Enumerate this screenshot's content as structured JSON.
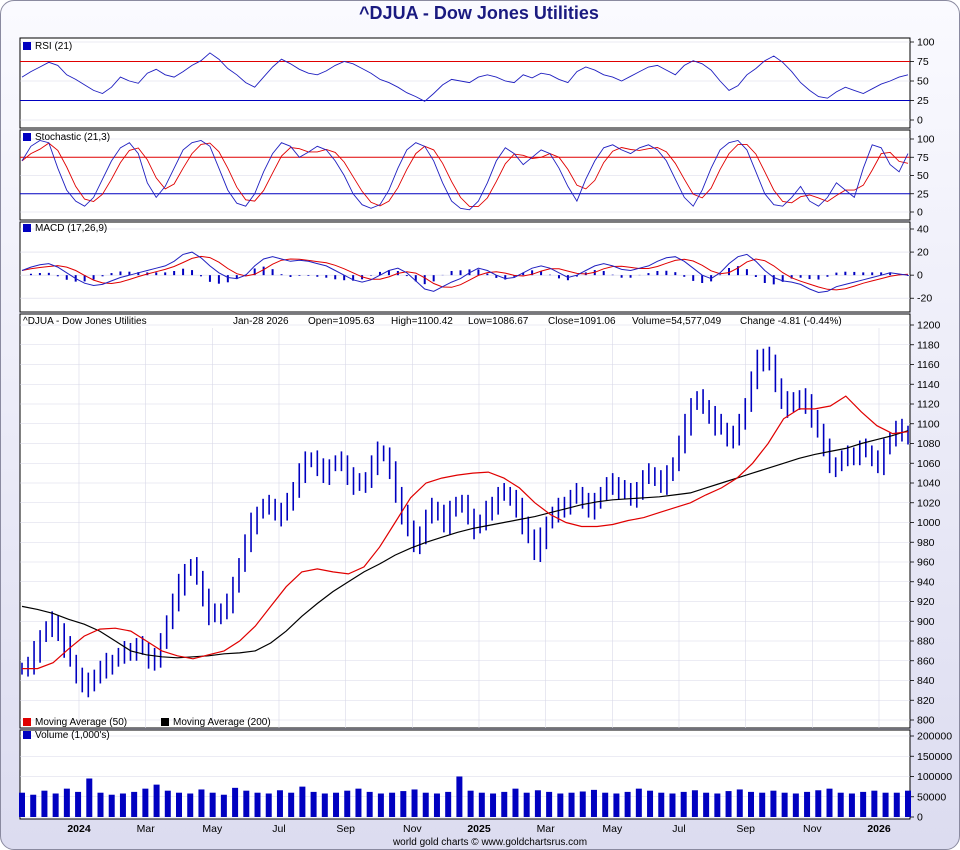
{
  "title": "^DJUA - Dow Jones Utilities",
  "footer": "world gold charts © www.goldchartsrus.com",
  "colors": {
    "price": "#0000c0",
    "ma50": "#e00000",
    "ma200": "#000000",
    "rsi": "#2020c0",
    "ref_red": "#e00000",
    "ref_blue": "#0000c0",
    "volume": "#0000c0"
  },
  "chart_data": [
    {
      "type": "line",
      "panel": "rsi",
      "legend": "RSI (21)",
      "ylim": [
        0,
        100
      ],
      "ticks": [
        0,
        25,
        50,
        75,
        100
      ],
      "reference_lines": [
        25,
        75
      ],
      "series": [
        {
          "values": [
            55,
            62,
            68,
            74,
            70,
            58,
            52,
            45,
            38,
            34,
            42,
            55,
            50,
            47,
            60,
            65,
            58,
            55,
            62,
            70,
            76,
            86,
            78,
            66,
            58,
            48,
            42,
            55,
            68,
            78,
            72,
            65,
            60,
            58,
            63,
            70,
            75,
            72,
            66,
            60,
            52,
            48,
            42,
            35,
            30,
            24,
            34,
            45,
            52,
            50,
            48,
            55,
            58,
            55,
            50,
            48,
            58,
            54,
            60,
            58,
            52,
            48,
            62,
            68,
            64,
            58,
            55,
            50,
            56,
            62,
            68,
            70,
            64,
            58,
            70,
            76,
            72,
            64,
            50,
            38,
            44,
            58,
            66,
            76,
            82,
            74,
            62,
            48,
            38,
            30,
            28,
            36,
            42,
            38,
            34,
            40,
            46,
            50,
            55,
            58
          ]
        }
      ]
    },
    {
      "type": "line",
      "panel": "stochastic",
      "legend": "Stochastic (21,3)",
      "ylim": [
        0,
        100
      ],
      "ticks": [
        0,
        25,
        50,
        75,
        100
      ],
      "reference_lines": [
        25,
        75
      ],
      "series": [
        {
          "values": [
            70,
            90,
            98,
            95,
            60,
            30,
            15,
            8,
            20,
            45,
            70,
            88,
            95,
            80,
            40,
            20,
            35,
            60,
            85,
            95,
            98,
            90,
            60,
            30,
            12,
            8,
            25,
            55,
            80,
            95,
            90,
            75,
            82,
            90,
            85,
            70,
            50,
            25,
            10,
            5,
            10,
            30,
            60,
            85,
            95,
            90,
            70,
            40,
            15,
            5,
            3,
            15,
            40,
            70,
            88,
            80,
            65,
            75,
            85,
            80,
            60,
            35,
            15,
            45,
            70,
            88,
            92,
            85,
            80,
            88,
            92,
            85,
            70,
            45,
            20,
            8,
            30,
            60,
            85,
            95,
            98,
            85,
            55,
            25,
            10,
            8,
            20,
            35,
            15,
            8,
            20,
            40,
            30,
            20,
            60,
            92,
            88,
            65,
            55,
            80
          ]
        }
      ]
    },
    {
      "type": "line",
      "panel": "macd",
      "legend": "MACD (17,26,9)",
      "ylim": [
        -25,
        40
      ],
      "ticks": [
        -20,
        0,
        20,
        40
      ],
      "series": [
        {
          "values": [
            4,
            7,
            9,
            10,
            7,
            2,
            -3,
            -7,
            -9,
            -8,
            -5,
            -2,
            0,
            2,
            4,
            6,
            8,
            12,
            18,
            20,
            15,
            8,
            2,
            -2,
            -3,
            0,
            8,
            14,
            16,
            14,
            12,
            13,
            12,
            10,
            8,
            4,
            0,
            -4,
            -6,
            -4,
            0,
            4,
            6,
            2,
            -5,
            -12,
            -14,
            -10,
            -6,
            -3,
            2,
            6,
            4,
            0,
            -3,
            -2,
            2,
            6,
            8,
            6,
            2,
            -2,
            0,
            4,
            8,
            10,
            8,
            5,
            4,
            6,
            8,
            12,
            15,
            16,
            12,
            6,
            0,
            -3,
            2,
            10,
            16,
            18,
            12,
            4,
            -2,
            -5,
            -6,
            -8,
            -12,
            -15,
            -14,
            -10,
            -8,
            -6,
            -4,
            -2,
            0,
            2,
            1,
            0
          ]
        }
      ]
    },
    {
      "type": "line",
      "panel": "price",
      "info": {
        "label": "^DJUA - Dow Jones Utilities",
        "date": "Jan-28 2026",
        "open": "Open=1095.63",
        "high": "High=1100.42",
        "low": "Low=1086.67",
        "close": "Close=1091.06",
        "volume": "Volume=54,577,049",
        "change": "Change -4.81 (-0.44%)"
      },
      "ylim": [
        800,
        1200
      ],
      "ticks": [
        800,
        820,
        840,
        860,
        880,
        900,
        920,
        940,
        960,
        980,
        1000,
        1020,
        1040,
        1060,
        1080,
        1100,
        1120,
        1140,
        1160,
        1180,
        1200
      ],
      "x_ticks": [
        "2024",
        "Mar",
        "May",
        "Jul",
        "Sep",
        "Nov",
        "2025",
        "Mar",
        "May",
        "Jul",
        "Sep",
        "Nov",
        "2026"
      ],
      "legend": [
        "Moving Average (50)",
        "Moving Average (200)"
      ],
      "series": [
        {
          "name": "Moving Average (50)",
          "values": [
            852,
            852,
            858,
            872,
            885,
            892,
            893,
            890,
            880,
            870,
            865,
            862,
            866,
            870,
            880,
            895,
            915,
            935,
            950,
            953,
            950,
            948,
            955,
            975,
            1000,
            1025,
            1040,
            1045,
            1048,
            1050,
            1051,
            1045,
            1035,
            1020,
            1008,
            1000,
            996,
            996,
            998,
            1002,
            1005,
            1010,
            1015,
            1020,
            1028,
            1035,
            1045,
            1060,
            1080,
            1105,
            1115,
            1115,
            1118,
            1128,
            1112,
            1098,
            1090,
            1092
          ]
        },
        {
          "name": "Moving Average (200)",
          "values": [
            915,
            912,
            908,
            902,
            897,
            890,
            880,
            870,
            866,
            864,
            863,
            864,
            865,
            867,
            868,
            870,
            878,
            890,
            905,
            918,
            930,
            940,
            950,
            958,
            967,
            974,
            980,
            985,
            990,
            994,
            997,
            1000,
            1003,
            1006,
            1010,
            1014,
            1018,
            1021,
            1023,
            1024,
            1025,
            1026,
            1028,
            1030,
            1035,
            1040,
            1045,
            1050,
            1055,
            1060,
            1065,
            1069,
            1072,
            1075,
            1080,
            1084,
            1088,
            1093
          ]
        },
        {
          "name": "price",
          "values": [
            852,
            856,
            870,
            885,
            892,
            900,
            890,
            875,
            860,
            845,
            838,
            835,
            845,
            852,
            858,
            860,
            865,
            870,
            872,
            875,
            872,
            860,
            865,
            878,
            900,
            920,
            938,
            952,
            955,
            945,
            925,
            908,
            905,
            912,
            920,
            935,
            958,
            980,
            1000,
            1010,
            1016,
            1018,
            1012,
            1008,
            1020,
            1035,
            1052,
            1062,
            1065,
            1055,
            1050,
            1058,
            1060,
            1062,
            1048,
            1040,
            1038,
            1045,
            1060,
            1072,
            1068,
            1052,
            1030,
            1010,
            992,
            978,
            990,
            1005,
            1015,
            1010,
            1000,
            1012,
            1020,
            1018,
            1008,
            995,
            1000,
            1012,
            1020,
            1028,
            1030,
            1025,
            1015,
            1000,
            985,
            970,
            985,
            1000,
            1008,
            1015,
            1020,
            1025,
            1030,
            1022,
            1015,
            1020,
            1030,
            1038,
            1040,
            1035,
            1030,
            1025,
            1035,
            1045,
            1050,
            1045,
            1040,
            1048,
            1060,
            1080,
            1100,
            1120,
            1125,
            1118,
            1110,
            1100,
            1095,
            1085,
            1090,
            1100,
            1120,
            1145,
            1165,
            1170,
            1160,
            1140,
            1125,
            1118,
            1122,
            1128,
            1120,
            1108,
            1092,
            1075,
            1060,
            1058,
            1065,
            1068,
            1070,
            1075,
            1072,
            1065,
            1060,
            1075,
            1085,
            1095,
            1092,
            1091
          ]
        }
      ]
    },
    {
      "type": "bar",
      "panel": "volume",
      "legend": "Volume (1,000's)",
      "ylim": [
        0,
        200000
      ],
      "ticks": [
        0,
        50000,
        100000,
        150000,
        200000
      ],
      "values": [
        60000,
        55000,
        65000,
        58000,
        70000,
        62000,
        95000,
        60000,
        55000,
        58000,
        62000,
        70000,
        80000,
        65000,
        60000,
        58000,
        68000,
        60000,
        55000,
        72000,
        65000,
        60000,
        58000,
        66000,
        60000,
        75000,
        62000,
        58000,
        60000,
        65000,
        70000,
        62000,
        58000,
        60000,
        64000,
        68000,
        60000,
        58000,
        62000,
        100000,
        65000,
        60000,
        58000,
        62000,
        70000,
        60000,
        66000,
        62000,
        58000,
        60000,
        63000,
        67000,
        60000,
        58000,
        62000,
        70000,
        65000,
        60000,
        58000,
        62000,
        66000,
        60000,
        58000,
        64000,
        68000,
        62000,
        60000,
        65000,
        60000,
        58000,
        62000,
        66000,
        70000,
        60000,
        58000,
        62000,
        65000,
        60000,
        60000,
        65000
      ]
    }
  ]
}
